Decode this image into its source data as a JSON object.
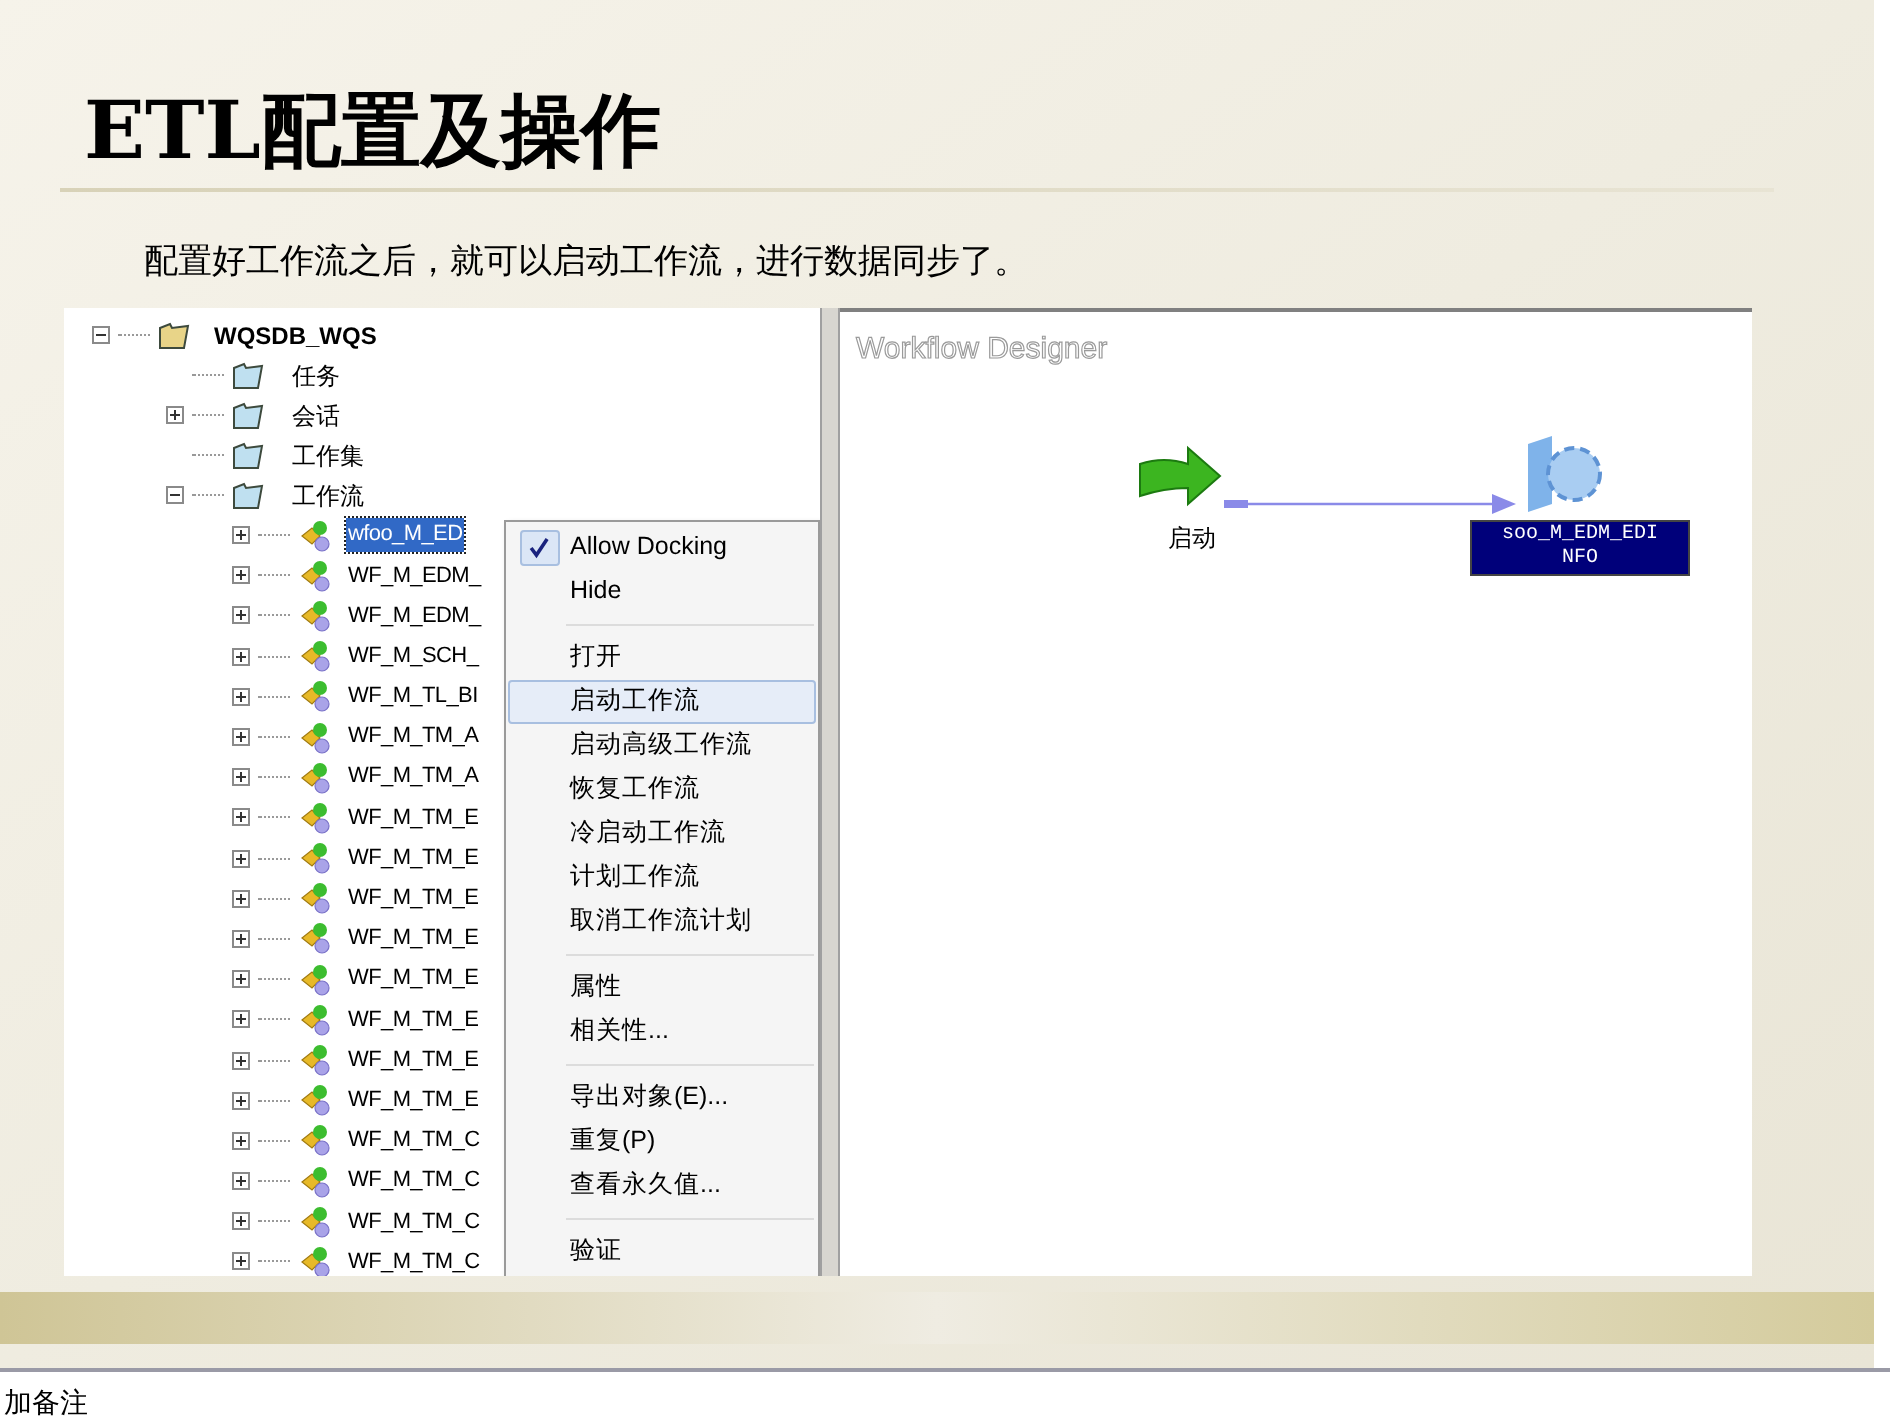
{
  "slide": {
    "title": "ETL配置及操作",
    "subtitle": "配置好工作流之后，就可以启动工作流，进行数据同步了。"
  },
  "tree": {
    "root": {
      "label": "WQSDB_WQS",
      "expanded": true
    },
    "folders": [
      {
        "label": "任务",
        "kind": "leaf"
      },
      {
        "label": "会话",
        "kind": "branch",
        "expanded": false
      },
      {
        "label": "工作集",
        "kind": "leaf"
      },
      {
        "label": "工作流",
        "kind": "branch",
        "expanded": true
      }
    ],
    "workflows": [
      {
        "label": "wfoo_M_ED",
        "selected": true
      },
      {
        "label": "WF_M_EDM_",
        "selected": false
      },
      {
        "label": "WF_M_EDM_",
        "selected": false
      },
      {
        "label": "WF_M_SCH_",
        "selected": false
      },
      {
        "label": "WF_M_TL_BI",
        "selected": false
      },
      {
        "label": "WF_M_TM_A",
        "selected": false
      },
      {
        "label": "WF_M_TM_A",
        "selected": false
      },
      {
        "label": "WF_M_TM_E",
        "selected": false
      },
      {
        "label": "WF_M_TM_E",
        "selected": false
      },
      {
        "label": "WF_M_TM_E",
        "selected": false
      },
      {
        "label": "WF_M_TM_E",
        "selected": false
      },
      {
        "label": "WF_M_TM_E",
        "selected": false
      },
      {
        "label": "WF_M_TM_E",
        "selected": false
      },
      {
        "label": "WF_M_TM_E",
        "selected": false
      },
      {
        "label": "WF_M_TM_E",
        "selected": false
      },
      {
        "label": "WF_M_TM_C",
        "selected": false
      },
      {
        "label": "WF_M_TM_C",
        "selected": false
      },
      {
        "label": "WF_M_TM_C",
        "selected": false
      },
      {
        "label": "WF_M_TM_C",
        "selected": false
      }
    ]
  },
  "context_menu": [
    {
      "kind": "item",
      "label": "Allow Docking",
      "checked": true,
      "selected": false
    },
    {
      "kind": "item",
      "label": "Hide",
      "checked": false,
      "selected": false
    },
    {
      "kind": "separator"
    },
    {
      "kind": "item",
      "label": "打开",
      "checked": false,
      "selected": false
    },
    {
      "kind": "item",
      "label": "启动工作流",
      "checked": false,
      "selected": true
    },
    {
      "kind": "item",
      "label": "启动高级工作流",
      "checked": false,
      "selected": false
    },
    {
      "kind": "item",
      "label": "恢复工作流",
      "checked": false,
      "selected": false
    },
    {
      "kind": "item",
      "label": "冷启动工作流",
      "checked": false,
      "selected": false
    },
    {
      "kind": "item",
      "label": "计划工作流",
      "checked": false,
      "selected": false
    },
    {
      "kind": "item",
      "label": "取消工作流计划",
      "checked": false,
      "selected": false
    },
    {
      "kind": "separator"
    },
    {
      "kind": "item",
      "label": "属性",
      "checked": false,
      "selected": false
    },
    {
      "kind": "item",
      "label": "相关性...",
      "checked": false,
      "selected": false
    },
    {
      "kind": "separator"
    },
    {
      "kind": "item",
      "label": "导出对象(E)...",
      "checked": false,
      "selected": false
    },
    {
      "kind": "item",
      "label": "重复(P)",
      "checked": false,
      "selected": false
    },
    {
      "kind": "item",
      "label": "查看永久值...",
      "checked": false,
      "selected": false
    },
    {
      "kind": "separator"
    },
    {
      "kind": "item",
      "label": "验证",
      "checked": false,
      "selected": false
    }
  ],
  "designer": {
    "title": "Workflow Designer",
    "start_node": {
      "label": "启动"
    },
    "task_node": {
      "label_lines": [
        "soo_M_EDM_EDI",
        "NFO"
      ]
    }
  },
  "notes": {
    "placeholder": "加备注"
  }
}
